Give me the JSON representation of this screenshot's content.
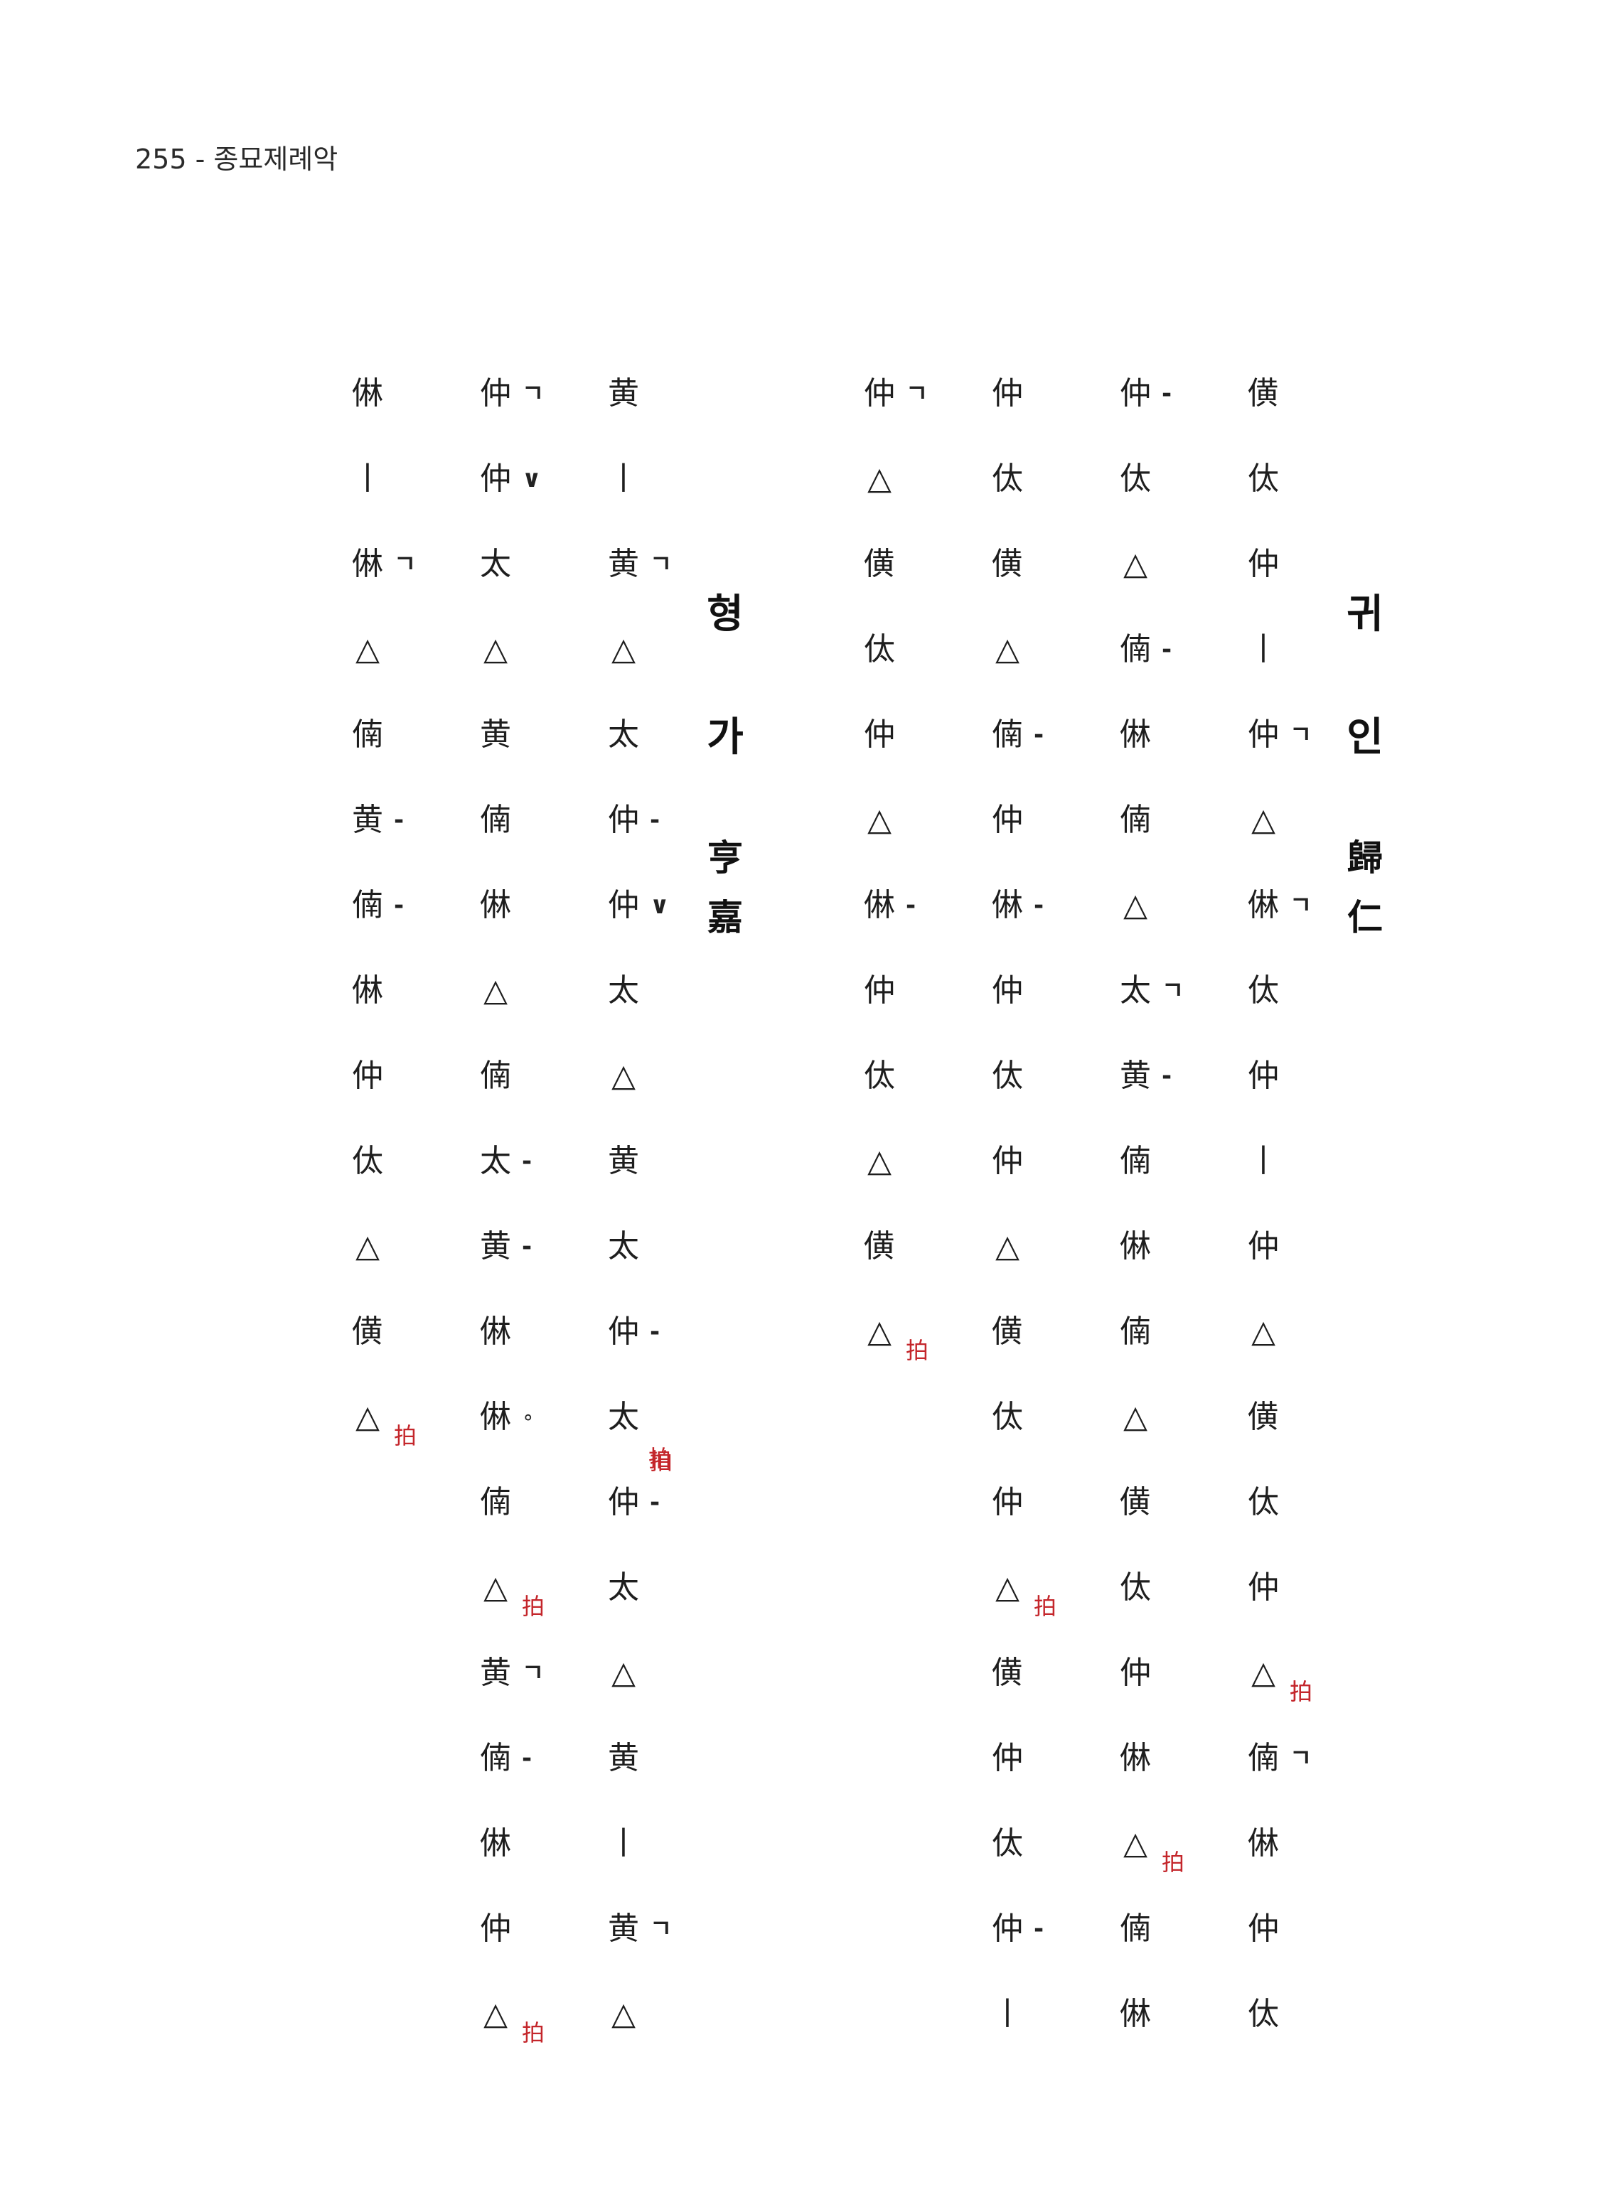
{
  "header": "255 - 종묘제례악",
  "titles": [
    {
      "hangul": [
        "귀",
        "인"
      ],
      "hanja": [
        "歸",
        "仁"
      ]
    },
    {
      "hangul": [
        "형",
        "가"
      ],
      "hanja": [
        "亨",
        "嘉"
      ]
    }
  ],
  "beat_mark": "拍",
  "columns": [
    [
      "僙",
      "㑀",
      "仲",
      "丨",
      "仲",
      "△",
      "㑣",
      "㑀",
      "仲",
      "丨",
      "仲",
      "△",
      "僙",
      "㑀",
      "仲",
      "△",
      "㑲",
      "㑣",
      "仲",
      "㑀"
    ],
    [
      "仲",
      "㑀",
      "△",
      "㑲",
      "㑣",
      "㑲",
      "△",
      "太",
      "黄",
      "㑲",
      "㑣",
      "㑲",
      "△",
      "僙",
      "㑀",
      "仲",
      "㑣",
      "△",
      "㑲",
      "㑣"
    ],
    [
      "仲",
      "㑀",
      "僙",
      "△",
      "㑲",
      "仲",
      "㑣",
      "仲",
      "㑀",
      "仲",
      "△",
      "僙",
      "㑀",
      "仲",
      "△",
      "僙",
      "仲",
      "㑀",
      "仲",
      "丨"
    ],
    [
      "仲",
      "△",
      "僙",
      "㑀",
      "仲",
      "△",
      "㑣",
      "仲",
      "㑀",
      "△",
      "僙",
      "△"
    ],
    [
      "黄",
      "丨",
      "黄",
      "△",
      "太",
      "仲",
      "仲",
      "太",
      "△",
      "黄",
      "太",
      "仲",
      "太",
      "仲",
      "太",
      "△",
      "黄",
      "丨",
      "黄",
      "△"
    ],
    [
      "仲",
      "仲",
      "太",
      "△",
      "黄",
      "㑲",
      "㑣",
      "△",
      "㑲",
      "太",
      "黄",
      "㑣",
      "㑣",
      "㑲",
      "△",
      "黄",
      "㑲",
      "㑣",
      "仲",
      "△"
    ],
    [
      "㑣",
      "丨",
      "㑣",
      "△",
      "㑲",
      "黄",
      "㑲",
      "㑣",
      "仲",
      "㑀",
      "△",
      "僙",
      "△"
    ]
  ],
  "markers": [
    [
      "",
      "",
      "",
      "",
      "ㄱ",
      "",
      "ㄱ",
      "",
      "",
      "",
      "",
      "",
      "",
      "",
      "",
      "",
      "ㄱ",
      "",
      "",
      "",
      ""
    ],
    [
      "-",
      "",
      "",
      "-",
      "",
      "",
      "",
      "ㄱ",
      "-",
      "",
      "",
      "",
      "",
      "",
      "",
      "",
      "",
      "",
      "",
      "",
      "-",
      "-"
    ],
    [
      "",
      "",
      "",
      "",
      "-",
      "",
      "-",
      "",
      "",
      "",
      "",
      "",
      "",
      "",
      "",
      "",
      "",
      "",
      "-",
      "",
      "",
      ""
    ],
    [
      "ㄱ",
      "",
      "",
      "",
      "",
      "",
      "-",
      "",
      "",
      "",
      "",
      ""
    ],
    [
      "",
      "",
      "ㄱ",
      "",
      "",
      "-",
      "∨",
      "",
      "",
      "",
      "",
      "-",
      "",
      "-",
      "",
      "",
      "",
      "",
      "ㄱ",
      ""
    ],
    [
      "ㄱ",
      "∨",
      "",
      "",
      "",
      "",
      "",
      "",
      "",
      "-",
      "-",
      "",
      "∘",
      "",
      "",
      "ㄱ",
      "-",
      "",
      "",
      ""
    ],
    [
      "",
      "",
      "ㄱ",
      "",
      "",
      "-",
      "-",
      "",
      "",
      "",
      "",
      "",
      ""
    ]
  ]
}
